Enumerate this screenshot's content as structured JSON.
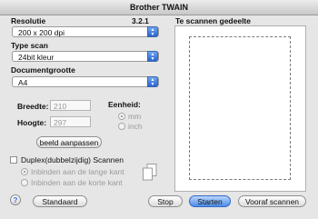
{
  "window": {
    "title": "Brother TWAIN",
    "version": "3.2.1"
  },
  "resolution": {
    "label": "Resolutie",
    "value": "200 x 200 dpi"
  },
  "scan_type": {
    "label": "Type scan",
    "value": "24bit kleur"
  },
  "document_size": {
    "label": "Documentgrootte",
    "value": "A4"
  },
  "dimensions": {
    "width_label": "Breedte:",
    "width_value": "210",
    "height_label": "Hoogte:",
    "height_value": "297",
    "unit_label": "Eenheid:",
    "unit_options": [
      "mm",
      "inch"
    ],
    "unit_selected": "mm"
  },
  "adjust_button": "beeld aanpassen",
  "duplex": {
    "label": "Duplex(dubbelzijdig) Scannen",
    "checked": false,
    "options": [
      "Inbinden aan de lange kant",
      "Inbinden aan de korte kant"
    ]
  },
  "preview": {
    "label": "Te scannen gedeelte"
  },
  "buttons": {
    "help": "?",
    "default": "Standaard",
    "stop": "Stop",
    "start": "Starten",
    "prescan": "Vooraf scannen"
  }
}
